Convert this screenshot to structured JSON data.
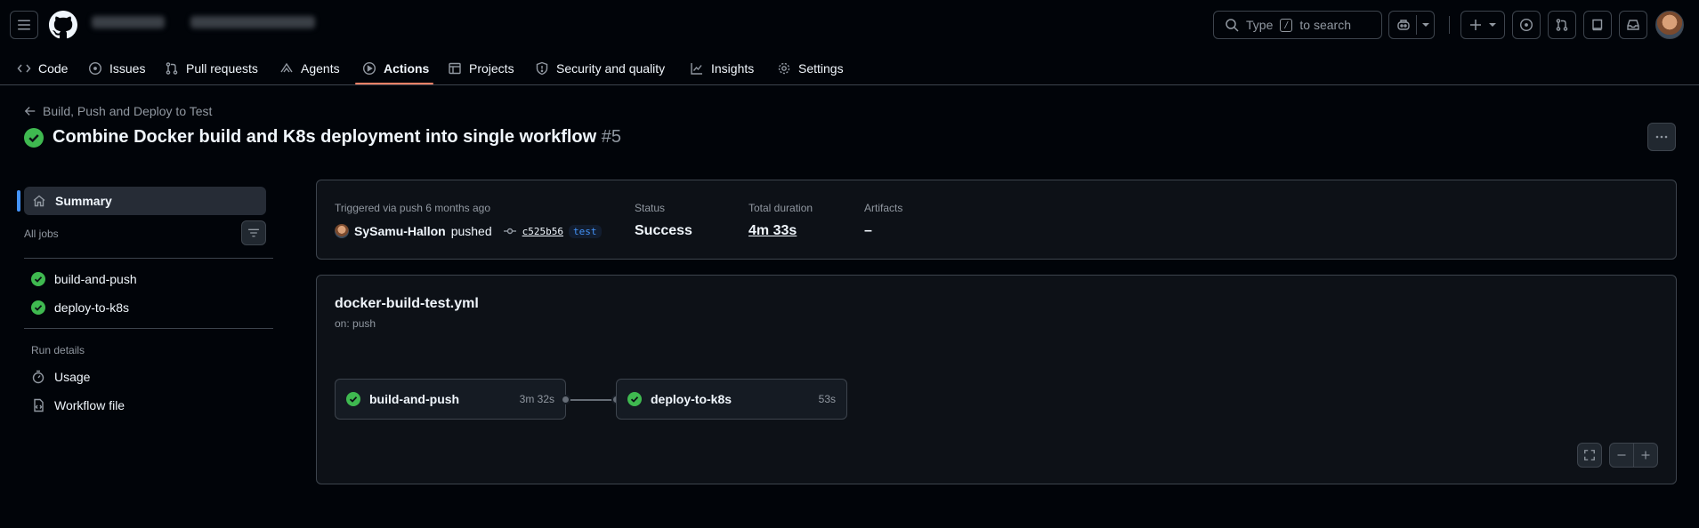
{
  "header": {
    "search_prefix": "Type",
    "search_key": "/",
    "search_suffix": "to search"
  },
  "nav": {
    "code": "Code",
    "issues": "Issues",
    "pull_requests": "Pull requests",
    "agents": "Agents",
    "actions": "Actions",
    "projects": "Projects",
    "security": "Security and quality",
    "insights": "Insights",
    "settings": "Settings"
  },
  "breadcrumb": {
    "back_label": "Build, Push and Deploy to Test"
  },
  "run": {
    "title": "Combine Docker build and K8s deployment into single workflow",
    "number": "#5"
  },
  "sidebar": {
    "summary": "Summary",
    "all_jobs": "All jobs",
    "jobs": [
      "build-and-push",
      "deploy-to-k8s"
    ],
    "run_details": "Run details",
    "usage": "Usage",
    "workflow_file": "Workflow file"
  },
  "summary": {
    "trigger_text": "Triggered via push 6 months ago",
    "actor": "SySamu-Hallon",
    "action": "pushed",
    "commit_sha": "c525b56",
    "branch": "test",
    "status_label": "Status",
    "status_value": "Success",
    "duration_label": "Total duration",
    "duration_value": "4m 33s",
    "artifacts_label": "Artifacts",
    "artifacts_value": "–"
  },
  "workflow": {
    "file": "docker-build-test.yml",
    "on": "on: push",
    "jobs": [
      {
        "name": "build-and-push",
        "time": "3m 32s"
      },
      {
        "name": "deploy-to-k8s",
        "time": "53s"
      }
    ]
  },
  "colors": {
    "success": "#3fb950",
    "accent": "#f78166",
    "link": "#4493f8"
  }
}
